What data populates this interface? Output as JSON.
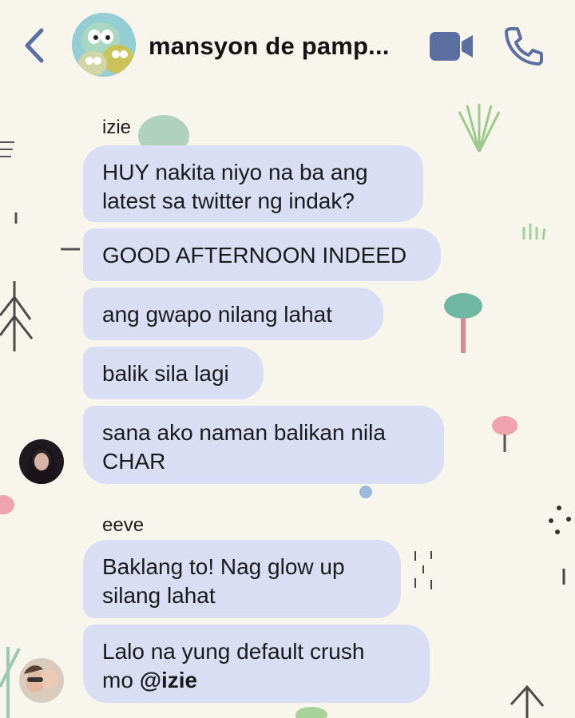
{
  "header": {
    "title": "mansyon de pamp...",
    "back_icon": "chevron-left-icon",
    "video_icon": "video-camera-icon",
    "call_icon": "phone-icon"
  },
  "colors": {
    "accent": "#5b6fa0",
    "bubble": "#d9def5",
    "background": "#f8f6ec"
  },
  "messages": [
    {
      "sender": "izie",
      "bubbles": [
        "HUY nakita niyo na ba ang",
        "latest sa twitter ng indak?",
        "GOOD AFTERNOON INDEED",
        "ang gwapo nilang lahat",
        "balik sila lagi",
        "sana ako naman balikan nila",
        "CHAR"
      ]
    },
    {
      "sender": "eeve",
      "bubbles": [
        "Baklang to! Nag glow up",
        "silang lahat",
        "Lalo na yung default crush",
        "mo",
        "@izie"
      ]
    }
  ]
}
